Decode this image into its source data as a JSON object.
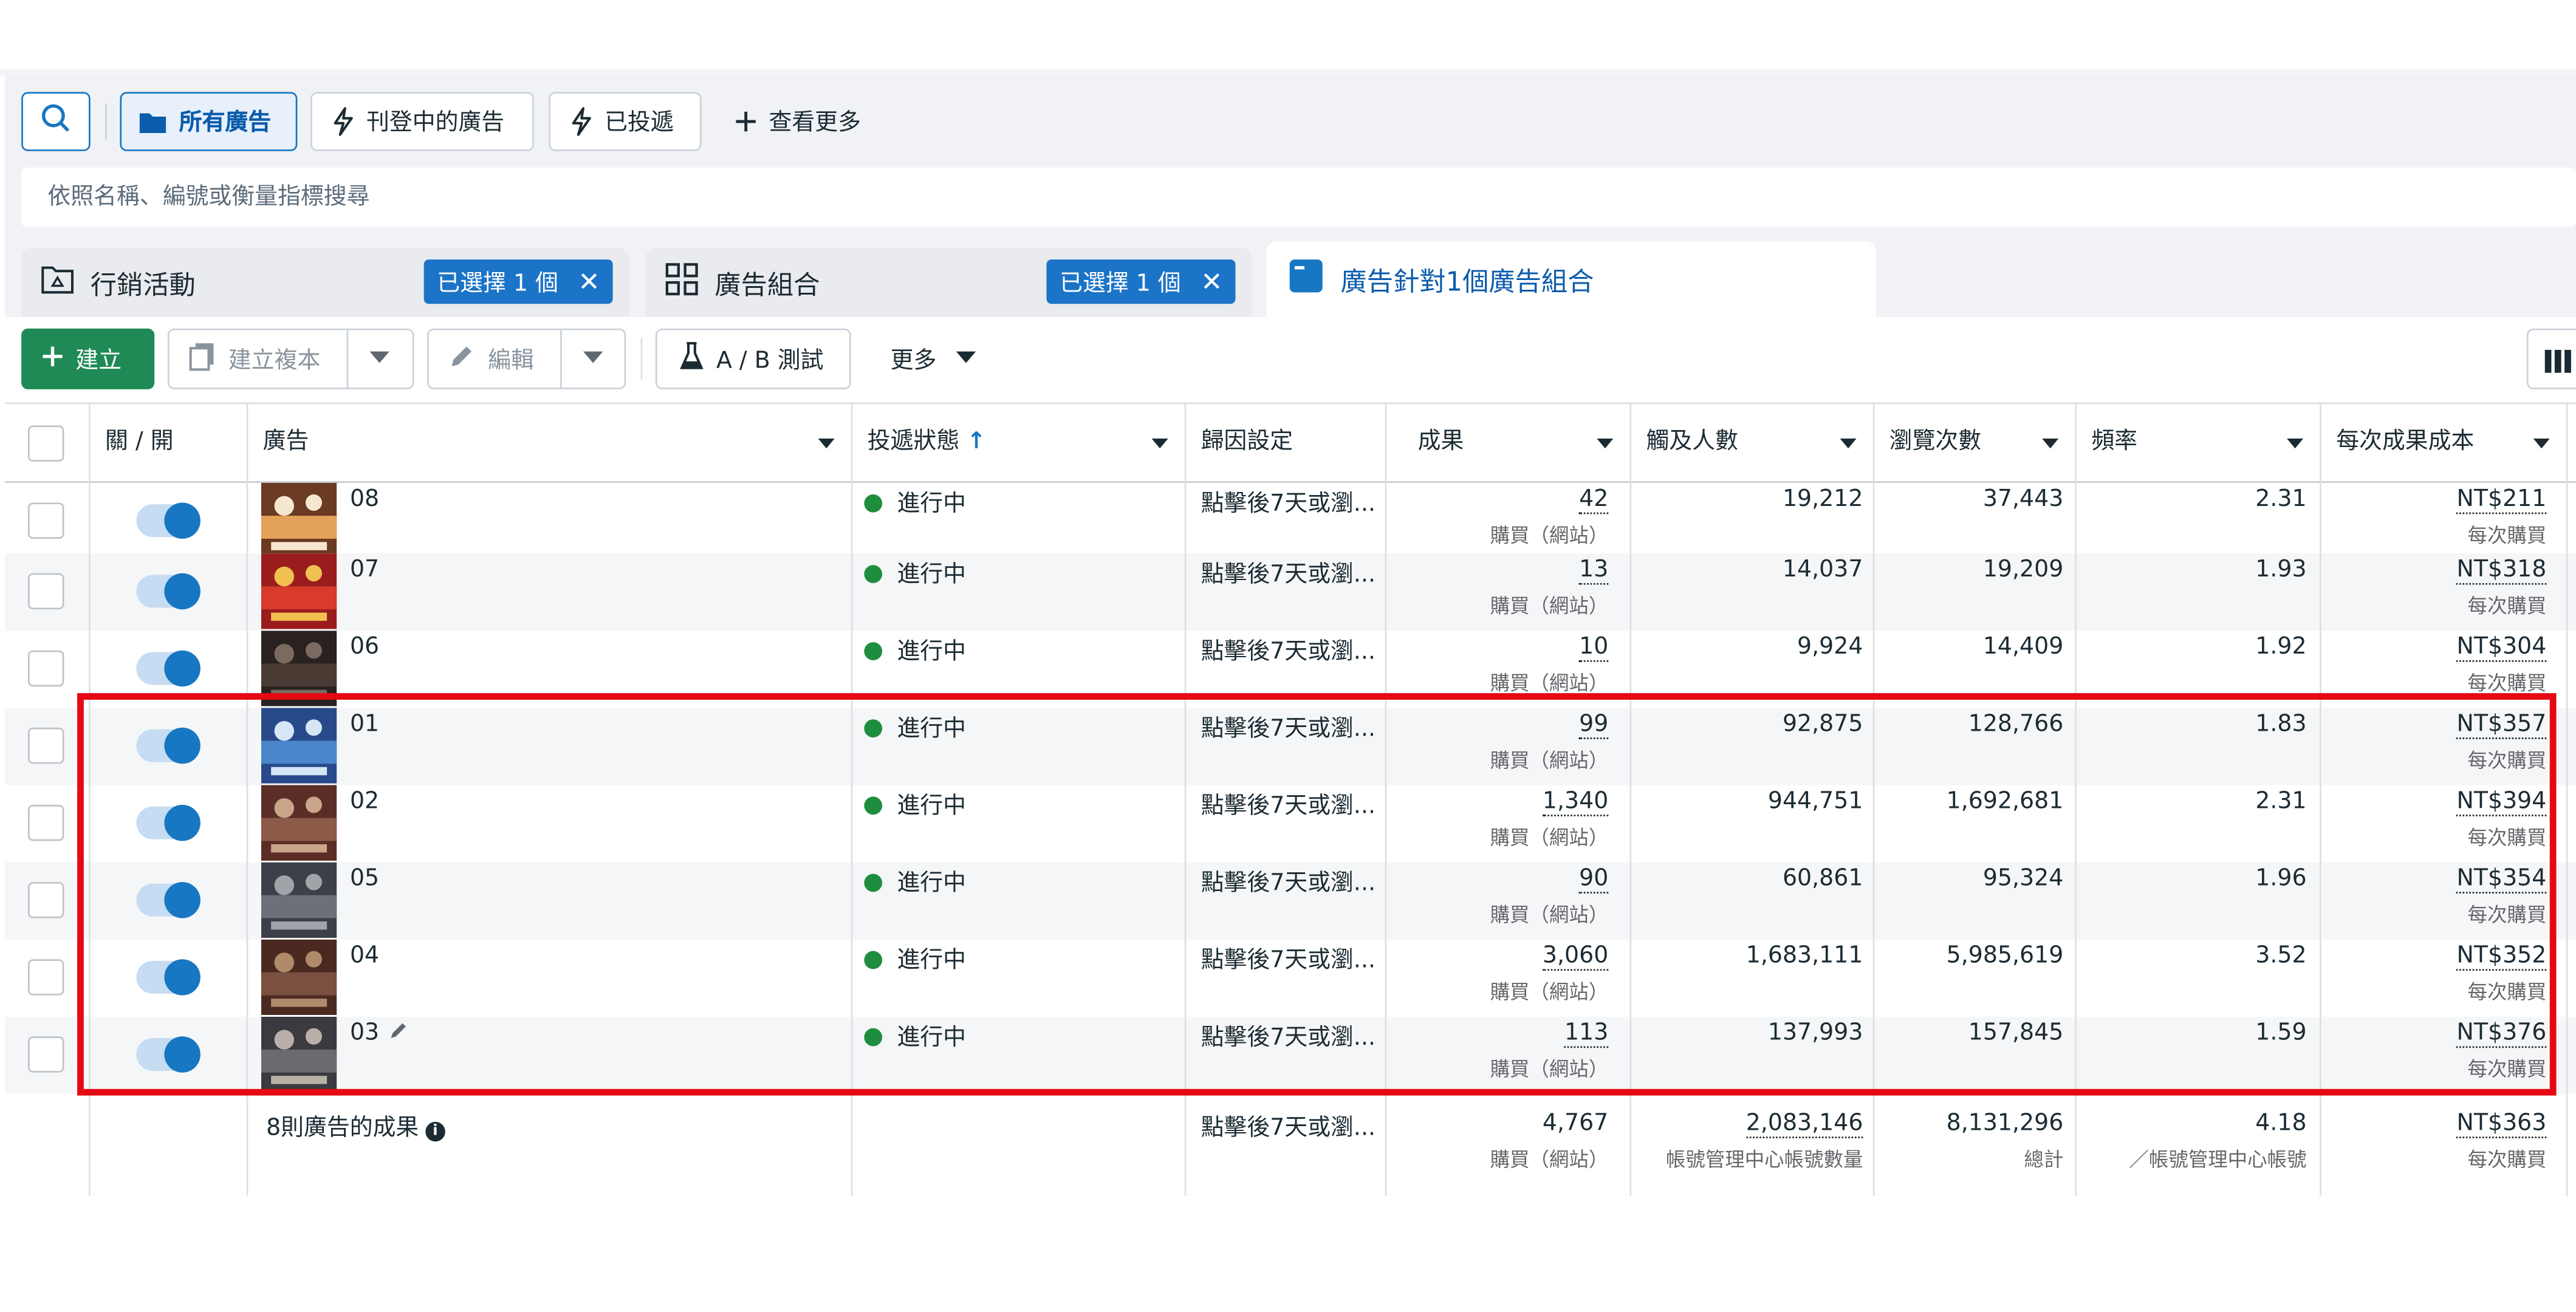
{
  "filters": {
    "all_ads": "所有廣告",
    "active_ads": "刊登中的廣告",
    "delivered": "已投遞",
    "view_more": "查看更多"
  },
  "search": {
    "placeholder": "依照名稱、編號或衡量指標搜尋"
  },
  "levels": {
    "campaign": {
      "label": "行銷活動",
      "chip": "已選擇 1 個"
    },
    "adset": {
      "label": "廣告組合",
      "chip": "已選擇 1 個"
    },
    "ads": {
      "label": "廣告針對1個廣告組合"
    }
  },
  "toolbar": {
    "create": "建立",
    "duplicate": "建立複本",
    "edit": "編輯",
    "abtest": "A / B 測試",
    "more": "更多"
  },
  "columns": {
    "toggle": "關 / 開",
    "ad": "廣告",
    "delivery": "投遞狀態",
    "delivery_sort": "↑",
    "attribution": "歸因設定",
    "results": "成果",
    "reach": "觸及人數",
    "impressions": "瀏覽次數",
    "frequency": "頻率",
    "cost": "每次成果成本"
  },
  "rows": [
    {
      "name": "08",
      "status": "進行中",
      "attribution": "點擊後7天或瀏...",
      "results": "42",
      "results_sub": "購買（網站）",
      "reach": "19,212",
      "impressions": "37,443",
      "frequency": "2.31",
      "cost": "NT$211",
      "cost_sub": "每次購買"
    },
    {
      "name": "07",
      "status": "進行中",
      "attribution": "點擊後7天或瀏...",
      "results": "13",
      "results_sub": "購買（網站）",
      "reach": "14,037",
      "impressions": "19,209",
      "frequency": "1.93",
      "cost": "NT$318",
      "cost_sub": "每次購買"
    },
    {
      "name": "06",
      "status": "進行中",
      "attribution": "點擊後7天或瀏...",
      "results": "10",
      "results_sub": "購買（網站）",
      "reach": "9,924",
      "impressions": "14,409",
      "frequency": "1.92",
      "cost": "NT$304",
      "cost_sub": "每次購買"
    },
    {
      "name": "01",
      "status": "進行中",
      "attribution": "點擊後7天或瀏...",
      "results": "99",
      "results_sub": "購買（網站）",
      "reach": "92,875",
      "impressions": "128,766",
      "frequency": "1.83",
      "cost": "NT$357",
      "cost_sub": "每次購買"
    },
    {
      "name": "02",
      "status": "進行中",
      "attribution": "點擊後7天或瀏...",
      "results": "1,340",
      "results_sub": "購買（網站）",
      "reach": "944,751",
      "impressions": "1,692,681",
      "frequency": "2.31",
      "cost": "NT$394",
      "cost_sub": "每次購買"
    },
    {
      "name": "05",
      "status": "進行中",
      "attribution": "點擊後7天或瀏...",
      "results": "90",
      "results_sub": "購買（網站）",
      "reach": "60,861",
      "impressions": "95,324",
      "frequency": "1.96",
      "cost": "NT$354",
      "cost_sub": "每次購買"
    },
    {
      "name": "04",
      "status": "進行中",
      "attribution": "點擊後7天或瀏...",
      "results": "3,060",
      "results_sub": "購買（網站）",
      "reach": "1,683,111",
      "impressions": "5,985,619",
      "frequency": "3.52",
      "cost": "NT$352",
      "cost_sub": "每次購買"
    },
    {
      "name": "03",
      "status": "進行中",
      "attribution": "點擊後7天或瀏...",
      "results": "113",
      "results_sub": "購買（網站）",
      "reach": "137,993",
      "impressions": "157,845",
      "frequency": "1.59",
      "cost": "NT$376",
      "cost_sub": "每次購買"
    }
  ],
  "summary": {
    "label": "8則廣告的成果",
    "attribution": "點擊後7天或瀏...",
    "results": "4,767",
    "results_sub": "購買（網站）",
    "reach": "2,083,146",
    "reach_sub": "帳號管理中心帳號數量",
    "impressions": "8,131,296",
    "impressions_sub": "總計",
    "frequency": "4.18",
    "frequency_sub": "／帳號管理中心帳號",
    "cost": "NT$363",
    "cost_sub": "每次購買"
  },
  "colors": {
    "accent": "#1877c2",
    "create_green": "#1f8a55",
    "active_green": "#1e8e3e",
    "highlight_red": "#e50914"
  },
  "icons": [
    "search-icon",
    "folder-icon",
    "lightning-icon",
    "plus-icon",
    "campaign-icon",
    "adset-grid-icon",
    "ad-icon",
    "close-icon",
    "copy-icon",
    "pencil-icon",
    "flask-icon",
    "chevron-down-icon",
    "columns-icon",
    "sort-up-icon",
    "info-icon"
  ]
}
